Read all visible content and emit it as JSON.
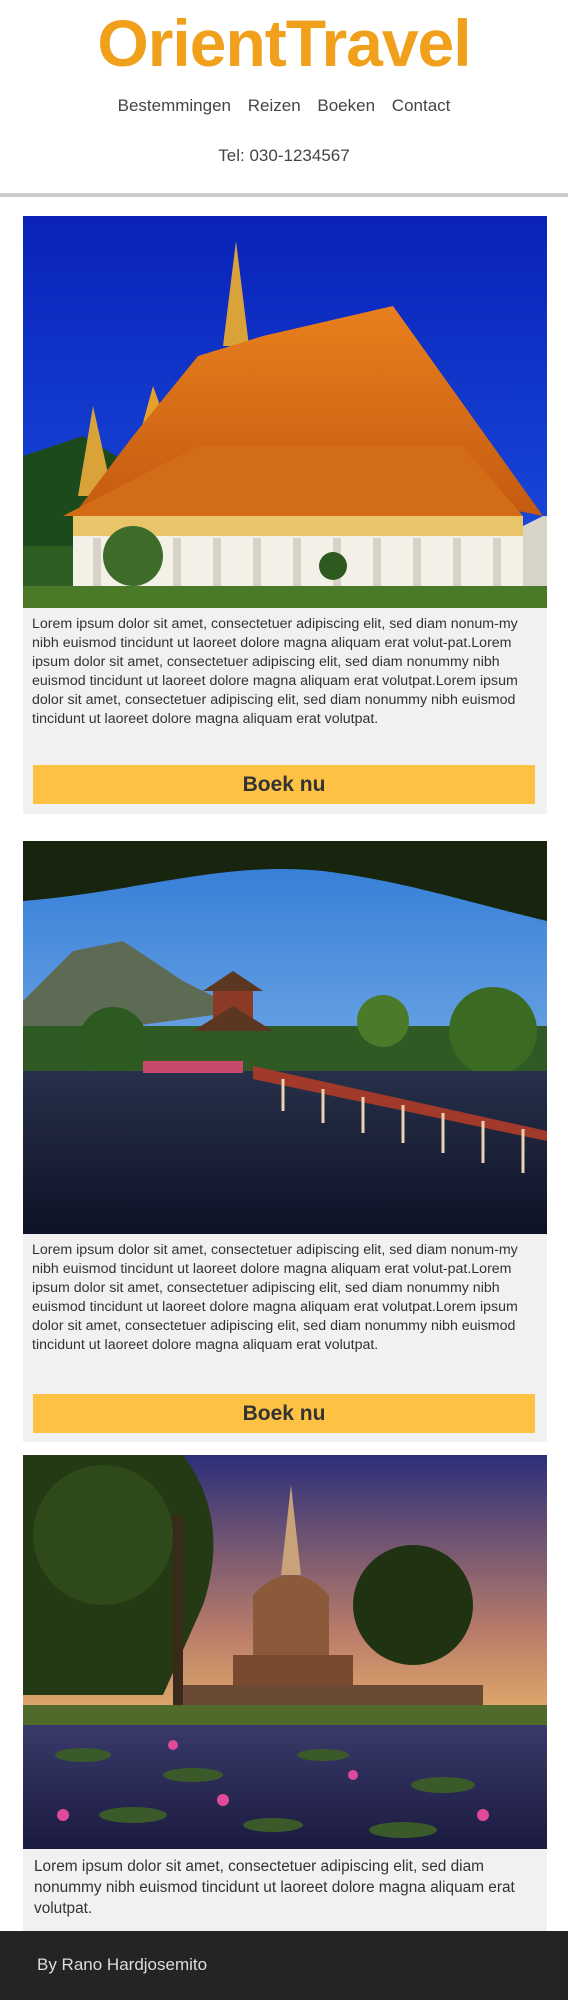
{
  "header": {
    "logo": "OrientTravel",
    "nav": [
      "Bestemmingen",
      "Reizen",
      "Boeken",
      "Contact"
    ],
    "phone": "Tel: 030-1234567"
  },
  "cards": [
    {
      "image": "cambodian-royal-palace-photo",
      "text": "Lorem ipsum dolor sit amet, consectetuer adipiscing elit, sed diam nonum-my nibh euismod tincidunt ut laoreet dolore magna aliquam erat volut-pat.Lorem ipsum dolor sit amet, consectetuer adipiscing elit, sed diam nonummy nibh euismod tincidunt ut laoreet dolore magna aliquam erat volutpat.Lorem ipsum dolor sit amet, consectetuer adipiscing elit, sed diam nonummy nibh euismod tincidunt ut laoreet dolore magna aliquam erat volutpat.",
      "button": "Boek nu"
    },
    {
      "image": "korean-pavilion-lake-photo",
      "text": "Lorem ipsum dolor sit amet, consectetuer adipiscing elit, sed diam nonum-my nibh euismod tincidunt ut laoreet dolore magna aliquam erat volut-pat.Lorem ipsum dolor sit amet, consectetuer adipiscing elit, sed diam nonummy nibh euismod tincidunt ut laoreet dolore magna aliquam erat volutpat.Lorem ipsum dolor sit amet, consectetuer adipiscing elit, sed diam nonummy nibh euismod tincidunt ut laoreet dolore magna aliquam erat volutpat.",
      "button": "Boek nu"
    },
    {
      "image": "thai-temple-lotus-pond-photo",
      "text": "Lorem ipsum dolor sit amet, consectetuer adipiscing elit, sed diam nonummy nibh euismod tincidunt ut laoreet dolore magna aliquam erat volutpat."
    }
  ],
  "footer": {
    "credit": "By Rano Hardjosemito"
  },
  "colors": {
    "brand": "#f0a01b",
    "button": "#fdc144",
    "card": "#f1f1f1",
    "footer": "#242424"
  }
}
